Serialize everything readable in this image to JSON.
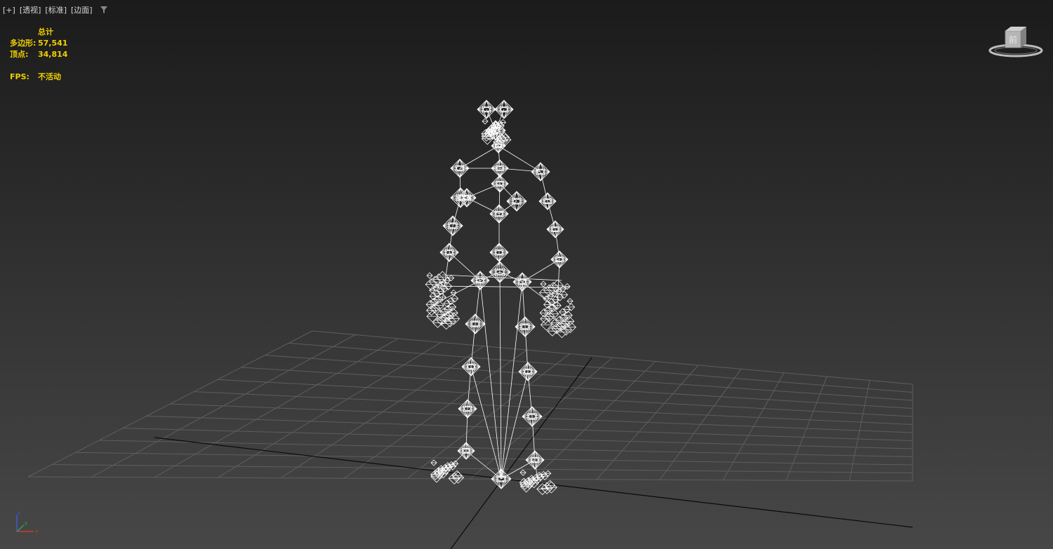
{
  "viewport": {
    "labels": [
      "[+]",
      "[透视]",
      "[标准]",
      "[边面]"
    ],
    "filter_icon": "filter-icon"
  },
  "stats": {
    "header": "总计",
    "polygons_label": "多边形:",
    "polygons_value": "57,541",
    "vertices_label": "顶点:",
    "vertices_value": "34,814",
    "fps_label": "FPS:",
    "fps_value": "不活动"
  },
  "viewcube": {
    "face_label": "前",
    "icon": "viewcube-icon"
  },
  "axis_tripod": {
    "x": "x",
    "y": "y",
    "z": "z",
    "colors": {
      "x": "#d23a2a",
      "y": "#2aa84a",
      "z": "#3a5ad8"
    }
  },
  "colors": {
    "stats_text": "#f0d000",
    "wireframe": "#ffffff",
    "grid": "#5e5e5e",
    "home_grid_axis": "#0a0a0a"
  }
}
